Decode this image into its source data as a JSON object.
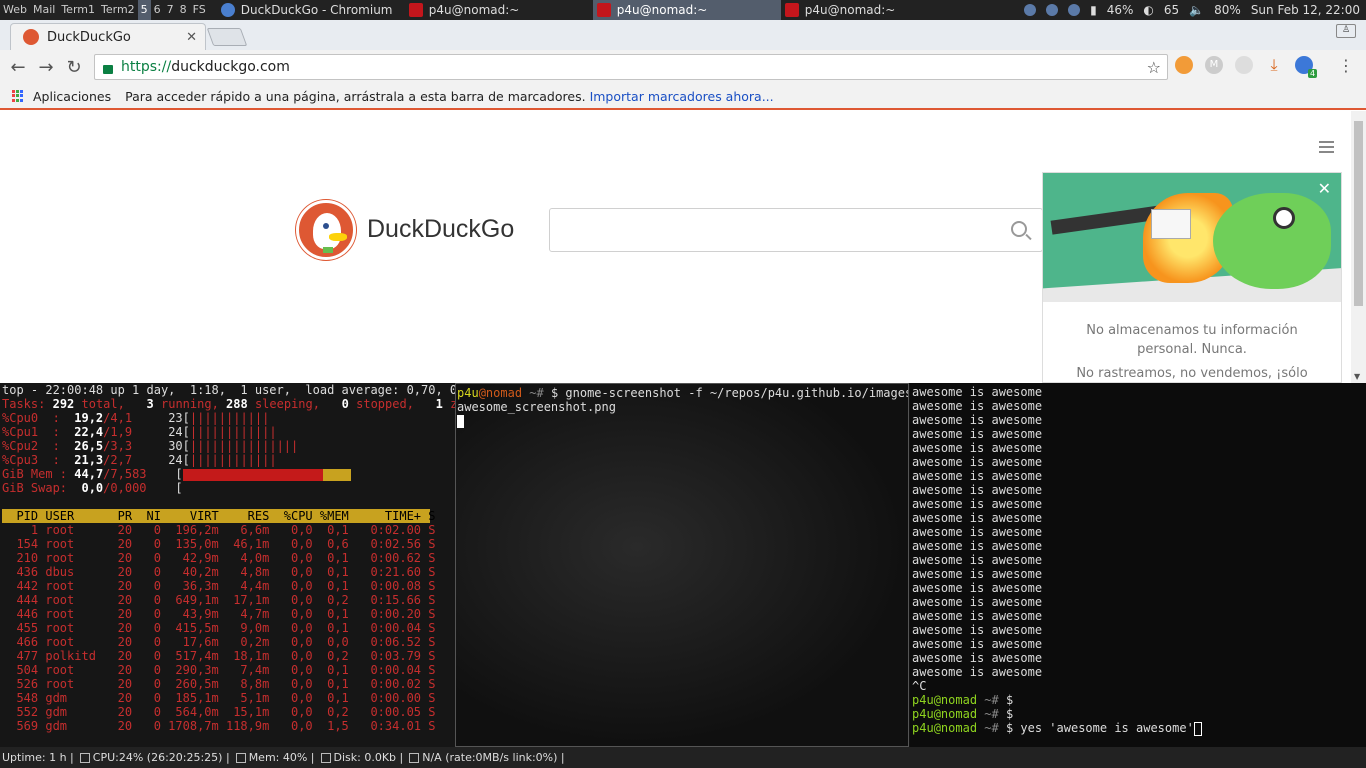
{
  "topbar": {
    "tags": [
      "Web",
      "Mail",
      "Term1",
      "Term2",
      "5",
      "6",
      "7",
      "8",
      "FS"
    ],
    "selected_tag": "5",
    "tasks": [
      {
        "label": "DuckDuckGo - Chromium",
        "icon": "chromium-icon"
      },
      {
        "label": "p4u@nomad:~",
        "icon": "terminal-icon"
      },
      {
        "label": "p4u@nomad:~",
        "icon": "terminal-icon"
      },
      {
        "label": "p4u@nomad:~",
        "icon": "terminal-icon"
      }
    ],
    "battery": "46%",
    "cpu_temp": "65",
    "volume": "80%",
    "clock": "Sun Feb 12, 22:00"
  },
  "browser": {
    "tab_title": "DuckDuckGo",
    "url_protocol": "https://",
    "url_host": "duckduckgo.com",
    "bookmarks_apps": "Aplicaciones",
    "bookmarks_hint": "Para acceder rápido a una página, arrástrala a esta barra de marcadores.",
    "bookmarks_link": "Importar marcadores ahora...",
    "ext_badge": "4",
    "ext_gmail": "M"
  },
  "ddg": {
    "name": "DuckDuckGo",
    "promo_line1": "No almacenamos tu información personal. Nunca.",
    "promo_line2": "No rastreamos, no vendemos, ¡sólo"
  },
  "htop": {
    "summary": "top - 22:00:48 up 1 day,  1:18,  1 user,  load average: 0,70, 0,",
    "tasks_label": "Tasks:",
    "tasks_total": "292",
    "tasks_total_label": " total,",
    "tasks_running": "3",
    "tasks_running_label": " running,",
    "tasks_sleeping": "288",
    "tasks_sleeping_label": " sleeping,",
    "tasks_stopped": "0",
    "tasks_stopped_label": " stopped,",
    "tasks_zombie": "1",
    "tasks_zombie_label": " zo",
    "cpus": [
      {
        "label": "%Cpu0  :",
        "val": "19,2",
        "sub": "/4,1",
        "n": "23",
        "bar": "|||||||||||"
      },
      {
        "label": "%Cpu1  :",
        "val": "22,4",
        "sub": "/1,9",
        "n": "24",
        "bar": "||||||||||||"
      },
      {
        "label": "%Cpu2  :",
        "val": "26,5",
        "sub": "/3,3",
        "n": "30",
        "bar": "|||||||||||||||"
      },
      {
        "label": "%Cpu3  :",
        "val": "21,3",
        "sub": "/2,7",
        "n": "24",
        "bar": "||||||||||||"
      }
    ],
    "mem_label": "GiB Mem :",
    "mem_val": "44,7",
    "mem_sub": "/7,583",
    "swap_label": "GiB Swap:",
    "swap_val": "0,0",
    "swap_sub": "/0,000",
    "header": "  PID USER      PR  NI    VIRT    RES  %CPU %MEM     TIME+ S",
    "rows": [
      "    1 root      20   0  196,2m   6,6m   0,0  0,1   0:02.00 S",
      "  154 root      20   0  135,0m  46,1m   0,0  0,6   0:02.56 S",
      "  210 root      20   0   42,9m   4,0m   0,0  0,1   0:00.62 S",
      "  436 dbus      20   0   40,2m   4,8m   0,0  0,1   0:21.60 S",
      "  442 root      20   0   36,3m   4,4m   0,0  0,1   0:00.08 S",
      "  444 root      20   0  649,1m  17,1m   0,0  0,2   0:15.66 S",
      "  446 root      20   0   43,9m   4,7m   0,0  0,1   0:00.20 S",
      "  455 root      20   0  415,5m   9,0m   0,0  0,1   0:00.04 S",
      "  466 root      20   0   17,6m   0,2m   0,0  0,0   0:06.52 S",
      "  477 polkitd   20   0  517,4m  18,1m   0,0  0,2   0:03.79 S",
      "  504 root      20   0  290,3m   7,4m   0,0  0,1   0:00.04 S",
      "  526 root      20   0  260,5m   8,8m   0,0  0,1   0:00.02 S",
      "  548 gdm       20   0  185,1m   5,1m   0,0  0,1   0:00.00 S",
      "  552 gdm       20   0  564,0m  15,1m   0,0  0,2   0:00.05 S",
      "  569 gdm       20   0 1708,7m 118,9m   0,0  1,5   0:34.01 S"
    ]
  },
  "term2": {
    "user": "p4u",
    "at": "@",
    "host": "nomad",
    "path": " ~#",
    "cmd": " $ gnome-screenshot -f ~/repos/p4u.github.io/images/",
    "cmd_cont": "awesome_screenshot.png"
  },
  "term3": {
    "yes_line": "awesome is awesome",
    "yes_count": 21,
    "ctrl_c": "^C",
    "prompt_user": "p4u",
    "prompt_at": "@",
    "prompt_host": "nomad",
    "prompt_path": " ~#",
    "prompt_sym": " $",
    "last_cmd": " $ yes 'awesome is awesome'"
  },
  "statusbar": {
    "uptime": "Uptime: 1 h |",
    "cpu": "CPU:24% (26:20:25:25) |",
    "mem": "Mem: 40% |",
    "disk": "Disk: 0.0Kb |",
    "net": "N/A (rate:0MB/s link:0%) |"
  },
  "colors": {
    "ddg_orange": "#de5833",
    "htop_red": "#c62e2e",
    "htop_header": "#c8a21f",
    "prompt_green": "#8ed31f",
    "prompt_yellow": "#d6d61e"
  }
}
